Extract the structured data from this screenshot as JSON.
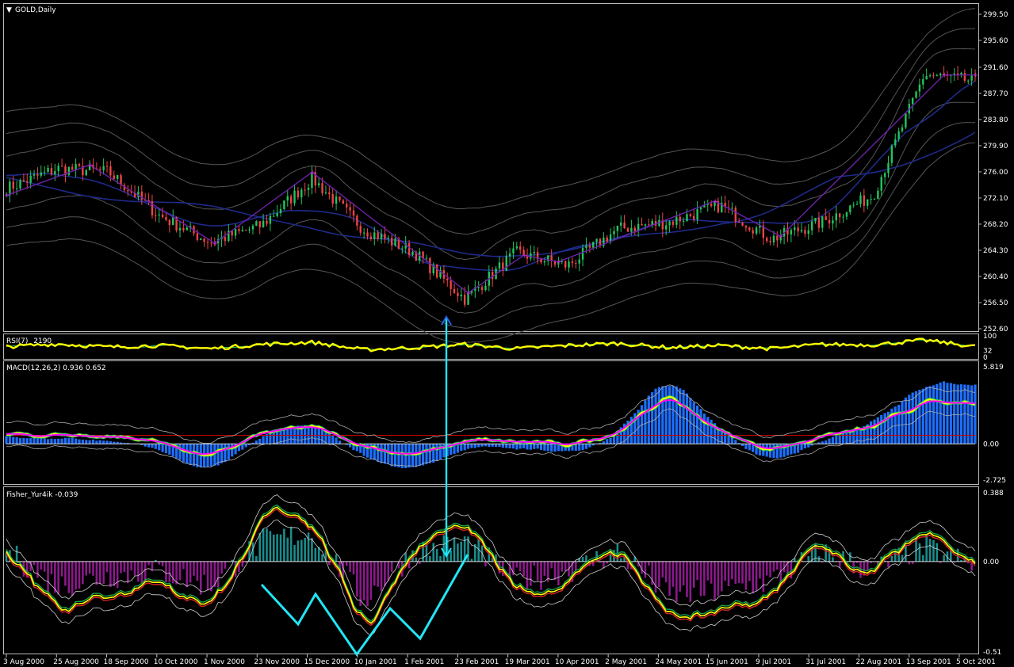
{
  "window": {
    "title": "GOLD,Daily"
  },
  "panes": {
    "price": {
      "title": "GOLD,Daily",
      "axis_ticks": [
        "299.50",
        "295.60",
        "291.60",
        "287.70",
        "283.80",
        "279.90",
        "276.00",
        "272.10",
        "268.20",
        "264.30",
        "260.40",
        "256.50",
        "252.60"
      ]
    },
    "rsi": {
      "label": "RSI(7)",
      "value": "2190",
      "ticks": [
        "100",
        "32",
        "0"
      ]
    },
    "macd": {
      "label": "MACD(12,26,2)",
      "value1": "0.936",
      "value2": "0.652",
      "ticks": [
        "5.819",
        "0.00",
        "-2.725"
      ]
    },
    "fisher": {
      "label": "Fisher_Yur4ik",
      "value": "-0.039",
      "ticks": [
        "0.388",
        "0.00",
        "-0.51"
      ]
    }
  },
  "date_labels": [
    "3 Aug 2000",
    "25 Aug 2000",
    "18 Sep 2000",
    "10 Oct 2000",
    "1 Nov 2000",
    "23 Nov 2000",
    "15 Dec 2000",
    "10 Jan 2001",
    "1 Feb 2001",
    "23 Feb 2001",
    "19 Mar 2001",
    "10 Apr 2001",
    "2 May 2001",
    "24 May 2001",
    "15 Jun 2001",
    "9 Jul 2001",
    "31 Jul 2001",
    "22 Aug 2001",
    "13 Sep 2001",
    "5 Oct 2001"
  ],
  "colors": {
    "up_candle": "#22c55e",
    "down_candle": "#ef4444",
    "zigzag": "#6b21a8",
    "rsi_line": "#ffff00",
    "macd_hist": "#1e6fff",
    "macd_main": "#ffff00",
    "macd_signal": "#ff00ff",
    "fisher_pos": "#1a8c8c",
    "fisher_neg": "#8b1a8b",
    "annotation": "#22e5f5"
  },
  "chart_data": [
    {
      "type": "candlestick",
      "title": "GOLD,Daily",
      "ylim": [
        252.6,
        299.5
      ],
      "x": [
        "3 Aug 2000",
        "25 Aug 2000",
        "18 Sep 2000",
        "10 Oct 2000",
        "1 Nov 2000",
        "23 Nov 2000",
        "15 Dec 2000",
        "10 Jan 2001",
        "1 Feb 2001",
        "23 Feb 2001",
        "19 Mar 2001",
        "10 Apr 2001",
        "2 May 2001",
        "24 May 2001",
        "15 Jun 2001",
        "9 Jul 2001",
        "31 Jul 2001",
        "22 Aug 2001",
        "13 Sep 2001",
        "5 Oct 2001"
      ],
      "series": [
        {
          "values": [
            273.5,
            276.5,
            276.0,
            269.5,
            265.5,
            268.0,
            275.0,
            267.5,
            264.0,
            257.0,
            264.0,
            262.0,
            267.5,
            268.5,
            271.0,
            266.0,
            268.5,
            272.5,
            290.5,
            289.5
          ]
        }
      ]
    },
    {
      "type": "line",
      "ylim": [
        0,
        100
      ],
      "series": [
        {
          "values": [
            50,
            62,
            48,
            55,
            40,
            60,
            70,
            35,
            45,
            60,
            40,
            55,
            65,
            45,
            55,
            40,
            60,
            58,
            80,
            50
          ]
        }
      ]
    },
    {
      "type": "bar",
      "ylim": [
        -2.725,
        5.819
      ],
      "series": [
        {
          "values": [
            0.4,
            0.5,
            0.3,
            -0.3,
            -2.4,
            0.6,
            1.5,
            -0.8,
            -2.2,
            -0.3,
            -0.4,
            -0.8,
            0.8,
            5.4,
            0.9,
            -1.4,
            0.3,
            1.3,
            4.6,
            4.2
          ]
        }
      ]
    },
    {
      "type": "bar",
      "ylim": [
        -0.51,
        0.388
      ],
      "series": [
        {
          "values": [
            0.1,
            -0.25,
            -0.15,
            -0.1,
            -0.25,
            0.2,
            0.3,
            -0.4,
            0.1,
            0.2,
            -0.2,
            -0.1,
            0.1,
            -0.35,
            -0.3,
            -0.2,
            0.1,
            -0.1,
            0.15,
            -0.05
          ]
        }
      ]
    }
  ]
}
